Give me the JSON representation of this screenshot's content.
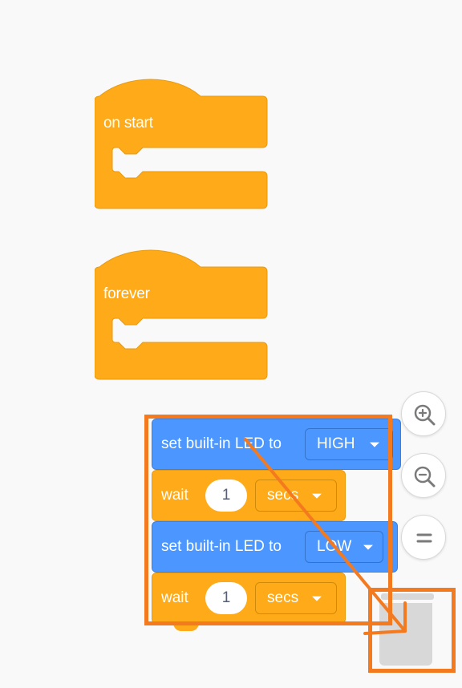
{
  "workspace": {
    "hat_blocks": [
      {
        "label": "on start"
      },
      {
        "label": "forever"
      }
    ],
    "stack": {
      "set_led_high": {
        "label": "set built-in LED to",
        "value": "HIGH"
      },
      "wait_1": {
        "label": "wait",
        "number": "1",
        "unit": "secs"
      },
      "set_led_low": {
        "label": "set built-in LED to",
        "value": "LOW"
      },
      "wait_2": {
        "label": "wait",
        "number": "1",
        "unit": "secs"
      }
    }
  },
  "controls": {
    "zoom_in_icon": "zoom-in-icon",
    "zoom_out_icon": "zoom-out-icon",
    "zoom_reset_icon": "equals-icon",
    "trash_icon": "trash-icon"
  },
  "colors": {
    "event_orange": "#ffab19",
    "led_blue": "#4c97ff",
    "annotation": "#f47a20",
    "trash_gray": "#d8d8d8"
  }
}
